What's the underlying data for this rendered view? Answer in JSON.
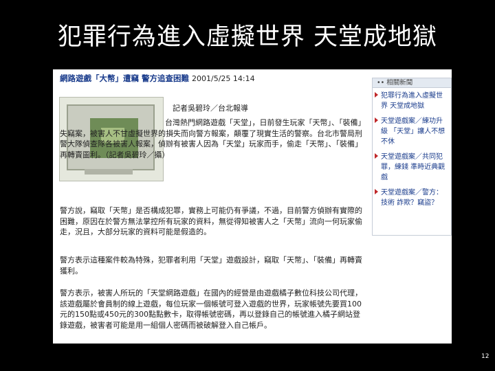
{
  "slide": {
    "title": "犯罪行為進入虛擬世界 天堂成地獄",
    "page_number": "12"
  },
  "article": {
    "headline": "網路遊戲「大幣」遭竊 警方追查困難",
    "date": "2001/5/25 14:14",
    "byline": "記者吳碧玲／台北報導",
    "paragraphs": [
      "台灣熱門網路遊戲「天堂」，日前發生玩家「天幣」、「裝備」失竊案，被害人不甘虛擬世界的損失而向警方報案，顛覆了現實生活的警察。台北市警局刑警大隊偵查隊各被害人報案，偵辦有被害人因為「天堂」玩家而手，偷走「天幣」、「裝備」再轉賣圖利。（記者吳碧玲／攝）",
      "警方說，竊取「天幣」是否構成犯罪，實務上可能仍有爭議，不過，目前警方偵辦有實際的困難，原因在於警方無法掌控所有玩家的資料，無從得知被害人之「天幣」流向一何玩家偷走，況且，大部分玩家的資料可能是假造的。",
      "警方表示這種案件較為特殊，犯罪者利用「天堂」遊戲設計，竊取「天幣」、「裝備」再轉賣獲利。",
      "警方表示，被害人所玩的「天堂網路遊戲」在國內的經營是由遊戲橘子數位科技公司代理，該遊戲屬於會員制的線上遊戲，每位玩家一個帳號可登入遊戲的世界，玩家帳號先要買100元的150點或450元的300點點數卡，取得帳號密碼，再以登錄自己的帳號進入橘子網站登錄遊戲，被害者可能是用一組個人密碼而被破解登入自己帳戶。"
    ]
  },
  "sidebar": {
    "header": "•• 相關新聞",
    "items": [
      "犯罪行為進入虛擬世界 天堂成地獄",
      "天堂遊戲案／練功升級 「天堂」讓人不想不休",
      "天堂遊戲案／共同犯罪，練錢 準時近典觀戲",
      "天堂遊戲案／警方：技術 詐欺？竊盜？"
    ]
  },
  "colors": {
    "headline": "#1a3c8c",
    "link": "#1a3c8c",
    "bullet": "#c0282a",
    "slide_background": "#000000"
  }
}
